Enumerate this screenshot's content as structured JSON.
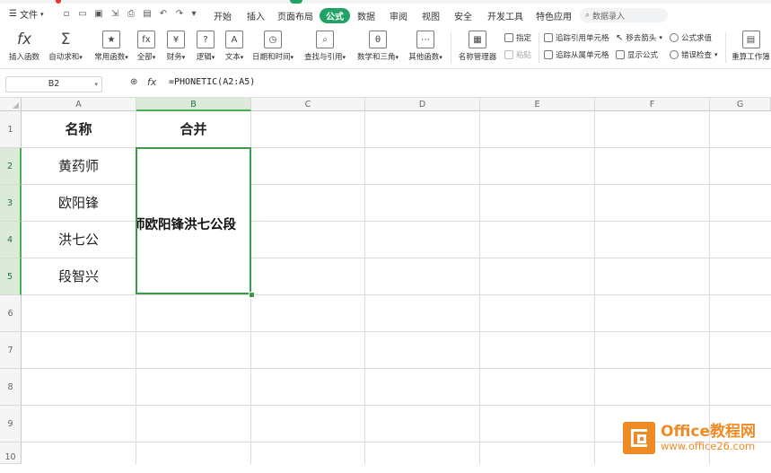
{
  "menubar": {
    "file_label": "文件",
    "tabs": [
      "开始",
      "插入",
      "页面布局",
      "公式",
      "数据",
      "审阅",
      "视图",
      "安全",
      "开发工具",
      "特色应用"
    ],
    "active_tab": "公式",
    "search_placeholder": "数据录入"
  },
  "ribbon": {
    "large_buttons": [
      {
        "label": "插入函数",
        "icon": "fx-icon"
      },
      {
        "label": "自动求和",
        "icon": "sigma-icon"
      },
      {
        "label": "常用函数",
        "icon": "common-functions-icon"
      },
      {
        "label": "全部",
        "icon": "all-functions-icon"
      },
      {
        "label": "财务",
        "icon": "finance-icon"
      },
      {
        "label": "逻辑",
        "icon": "logic-icon"
      },
      {
        "label": "文本",
        "icon": "text-icon"
      },
      {
        "label": "日期和时间",
        "icon": "clock-icon"
      },
      {
        "label": "查找与引用",
        "icon": "lookup-icon"
      },
      {
        "label": "数学和三角",
        "icon": "math-icon"
      },
      {
        "label": "其他函数",
        "icon": "more-functions-icon"
      },
      {
        "label": "名称管理器",
        "icon": "name-manager-icon"
      }
    ],
    "small_buttons": {
      "assign": "指定",
      "paste": "粘贴",
      "trace_precedents": "追踪引用单元格",
      "trace_dependents": "追踪从属单元格",
      "remove_arrows": "移去箭头",
      "show_formulas": "显示公式",
      "evaluate_formula": "公式求值",
      "error_check": "错误检查",
      "recalc": "重算工作簿"
    }
  },
  "formula_bar": {
    "name_box": "B2",
    "fx_label": "fx",
    "formula": "=PHONETIC(A2:A5)"
  },
  "grid": {
    "columns": [
      "A",
      "B",
      "C",
      "D",
      "E",
      "F",
      "G"
    ],
    "rows": [
      "1",
      "2",
      "3",
      "4",
      "5",
      "6",
      "7",
      "8",
      "9",
      "10"
    ],
    "header_a": "名称",
    "header_b": "合并",
    "names": [
      "黄药师",
      "欧阳锋",
      "洪七公",
      "段智兴"
    ],
    "merged_result": "师欧阳锋洪七公段"
  },
  "watermark": {
    "title": "Office教程网",
    "url": "www.office26.com"
  },
  "colors": {
    "accent": "#21a366",
    "selection": "#3c9a48",
    "watermark": "#f08a24"
  }
}
